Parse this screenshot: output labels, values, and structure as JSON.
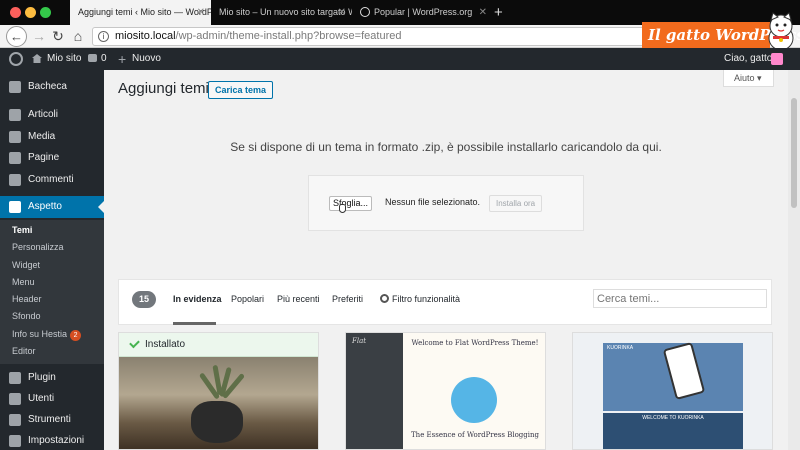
{
  "browser": {
    "tabs": [
      {
        "title": "Aggiungi temi ‹ Mio sito — WordPre",
        "active": true
      },
      {
        "title": "Mio sito – Un nuovo sito targato Wo",
        "active": false
      },
      {
        "title": "Popular | WordPress.org",
        "active": false
      }
    ],
    "url_host": "miosito.local",
    "url_path": "/wp-admin/theme-install.php?browse=featured",
    "brand": "Il gatto WordPress"
  },
  "adminbar": {
    "site_name": "Mio sito",
    "comments_count": "0",
    "new_label": "Nuovo",
    "greeting": "Ciao, gatto"
  },
  "sidebar": {
    "items": [
      {
        "label": "Bacheca",
        "icon": "dashboard-icon"
      },
      {
        "label": "Articoli",
        "icon": "pin-icon"
      },
      {
        "label": "Media",
        "icon": "media-icon"
      },
      {
        "label": "Pagine",
        "icon": "pages-icon"
      },
      {
        "label": "Commenti",
        "icon": "comment-icon"
      },
      {
        "label": "Aspetto",
        "icon": "brush-icon"
      },
      {
        "label": "Plugin",
        "icon": "plugin-icon"
      },
      {
        "label": "Utenti",
        "icon": "users-icon"
      },
      {
        "label": "Strumenti",
        "icon": "tools-icon"
      },
      {
        "label": "Impostazioni",
        "icon": "settings-icon"
      }
    ],
    "submenu": [
      "Temi",
      "Personalizza",
      "Widget",
      "Menu",
      "Header",
      "Sfondo",
      "Info su Hestia",
      "Editor"
    ],
    "hestia_badge": "2"
  },
  "main": {
    "help_label": "Aiuto",
    "title": "Aggiungi temi",
    "upload_button": "Carica tema",
    "description": "Se si dispone di un tema in formato .zip, è possibile installarlo caricandolo da qui.",
    "browse_button": "Sfoglia...",
    "no_file": "Nessun file selezionato.",
    "install_button": "Installa ora",
    "theme_count": "15",
    "filter_tabs": [
      "In evidenza",
      "Popolari",
      "Più recenti",
      "Preferiti"
    ],
    "feature_filter": "Filtro funzionalità",
    "search_placeholder": "Cerca temi...",
    "installed_label": "Installato",
    "theme2_title": "Welcome to Flat WordPress Theme!",
    "theme2_subtitle": "The Essence of WordPress Blogging",
    "theme2_logo": "Flat",
    "theme3_welcome": "WELCOME TO KUORINKA",
    "theme3_brand": "KUORINKA"
  },
  "colors": {
    "admin_dark": "#23282d",
    "accent_blue": "#0073aa",
    "brand_orange": "#f26b1d",
    "installed_green": "#46b450"
  }
}
